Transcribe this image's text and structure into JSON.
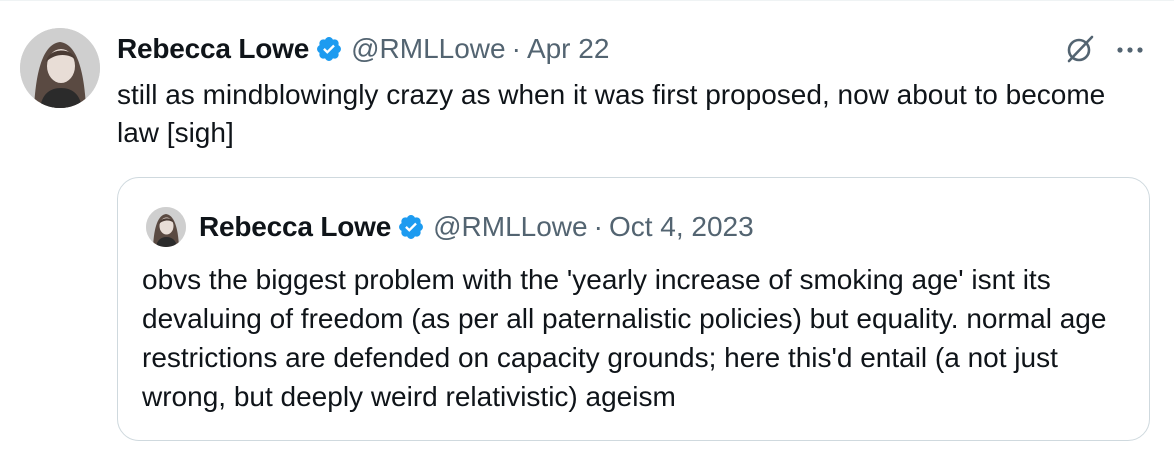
{
  "tweet": {
    "author": {
      "display_name": "Rebecca Lowe",
      "handle": "@RMLLowe",
      "verified": true,
      "avatar_icon": "avatar-photo"
    },
    "separator": "·",
    "date": "Apr 22",
    "text": "still as mindblowingly crazy as when it was first proposed, now about to become law [sigh]",
    "actions": {
      "grok_icon": "grok-icon",
      "more_icon": "more-icon"
    }
  },
  "quote": {
    "author": {
      "display_name": "Rebecca Lowe",
      "handle": "@RMLLowe",
      "verified": true,
      "avatar_icon": "avatar-photo"
    },
    "separator": "·",
    "date": "Oct 4, 2023",
    "text": "obvs the biggest problem with the 'yearly increase of smoking age' isnt its devaluing of freedom (as per all paternalistic policies) but equality. normal age restrictions are defended on capacity grounds; here this'd entail (a not just wrong, but deeply weird relativistic) ageism"
  },
  "colors": {
    "text_primary": "#0f1419",
    "text_secondary": "#536471",
    "verified_blue": "#1d9bf0",
    "border": "#cfd9de"
  }
}
